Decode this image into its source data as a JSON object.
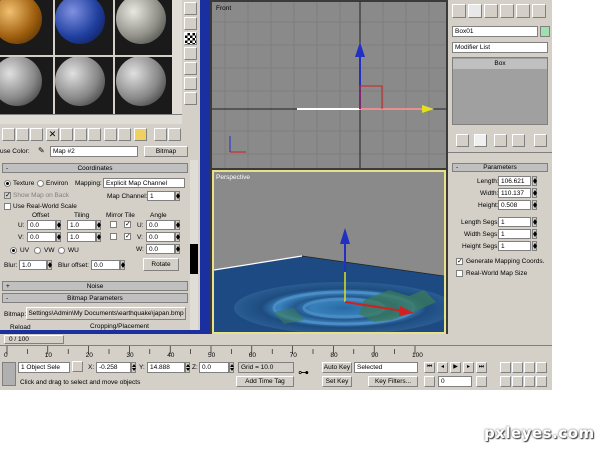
{
  "material_editor": {
    "map_label": "use Color:",
    "map_name": "Map #2",
    "map_type_btn": "Bitmap",
    "coordinates": {
      "title": "Coordinates",
      "texture": "Texture",
      "environ": "Environ",
      "mapping_label": "Mapping:",
      "mapping_value": "Explicit Map Channel",
      "show_map_on_back": "Show Map on Back",
      "map_channel_label": "Map Channel:",
      "map_channel": "1",
      "real_world": "Use Real-World Scale",
      "col_offset": "Offset",
      "col_tiling": "Tiling",
      "col_mirror_tile": "Mirror Tile",
      "col_angle": "Angle",
      "u": "U:",
      "v": "V:",
      "w": "W:",
      "u_offset": "0.0",
      "v_offset": "0.0",
      "u_tiling": "1.0",
      "v_tiling": "1.0",
      "u_angle": "0.0",
      "v_angle": "0.0",
      "w_angle": "0.0",
      "uv": "UV",
      "vw": "VW",
      "wu": "WU",
      "blur_label": "Blur:",
      "blur": "1.0",
      "blur_offset_label": "Blur offset:",
      "blur_offset": "0.0",
      "rotate": "Rotate"
    },
    "noise_title": "Noise",
    "bitmap_params_title": "Bitmap Parameters",
    "bitmap_label": "Bitmap:",
    "bitmap_path": "Settings\\Admin\\My Documents\\earthquake\\japan.bmp",
    "reload": "Reload",
    "cropping": "Cropping/Placement"
  },
  "viewports": {
    "front_label": "Front",
    "perspective_label": "Perspective"
  },
  "command_panel": {
    "object_name": "Box01",
    "modifier_list": "Modifier List",
    "stack_item": "Box",
    "parameters_title": "Parameters",
    "length_label": "Length:",
    "length": "106.621",
    "width_label": "Width:",
    "width": "110.137",
    "height_label": "Height:",
    "height": "0.508",
    "length_segs_label": "Length Segs:",
    "length_segs": "1",
    "width_segs_label": "Width Segs:",
    "width_segs": "1",
    "height_segs_label": "Height Segs:",
    "height_segs": "1",
    "gen_mapping": "Generate Mapping Coords.",
    "real_world_map": "Real-World Map Size"
  },
  "timeline": {
    "frame": "0 / 100",
    "ticks": [
      "0",
      "10",
      "20",
      "30",
      "40",
      "50",
      "60",
      "70",
      "80",
      "90",
      "100"
    ]
  },
  "status": {
    "selection": "1 Object Sele",
    "x_label": "X:",
    "x": "-0.258",
    "y_label": "Y:",
    "y": "14.888",
    "z_label": "Z:",
    "z": "0.0",
    "grid": "Grid = 10.0",
    "prompt": "Click and drag to select and move objects",
    "add_time_tag": "Add Time Tag",
    "auto_key": "Auto Key",
    "selected": "Selected",
    "set_key": "Set Key",
    "key_filters": "Key Filters...",
    "frame_field": "0"
  },
  "watermark": "pxleyes.com",
  "colors": {
    "viewport_bg": "#8a8a8a",
    "active_border": "#e7e28a",
    "frame_blue": "#1a2fa0",
    "panel": "#d4d0c8"
  }
}
